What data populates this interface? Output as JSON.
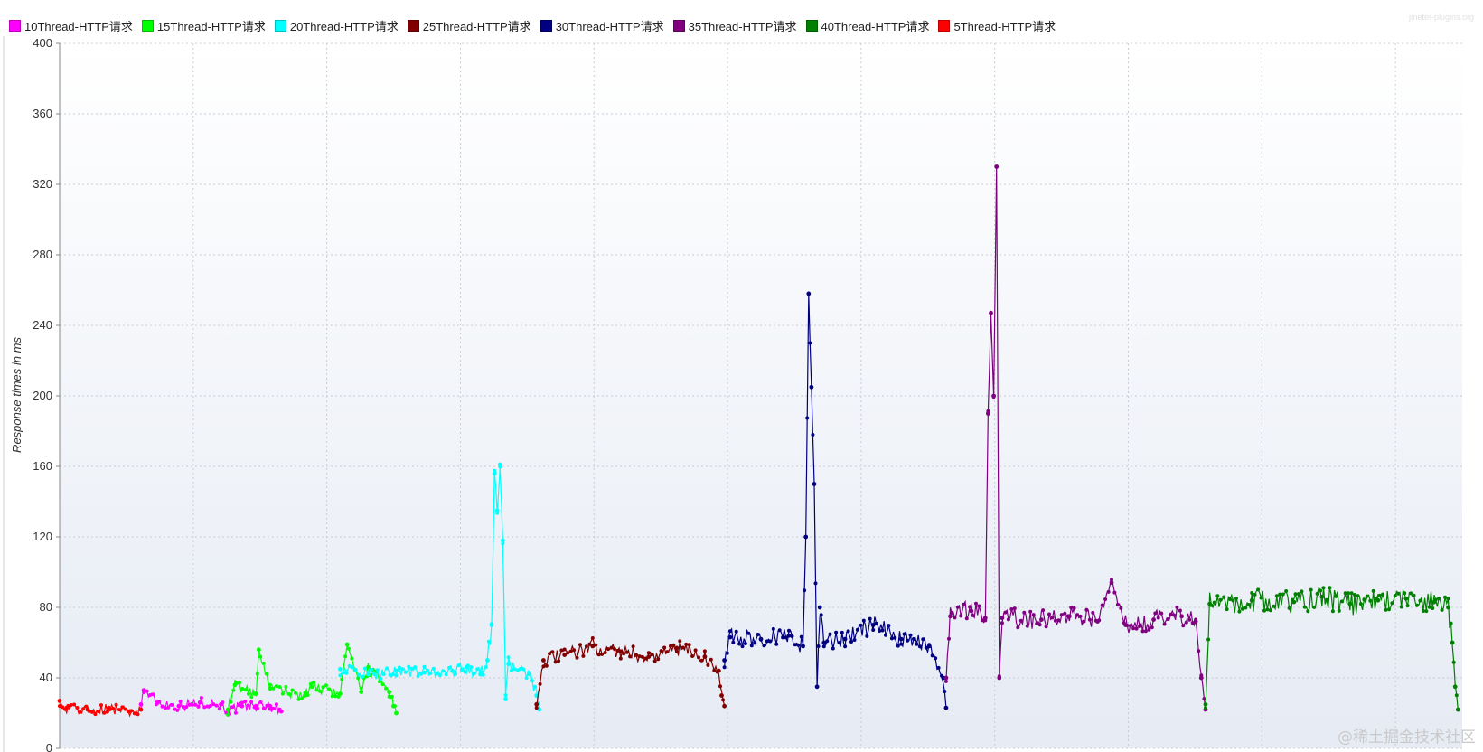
{
  "brand": "jmeter-plugins.org",
  "watermark": "@稀土掘金技术社区",
  "chart_data": {
    "type": "line",
    "title": "",
    "xlabel": "",
    "ylabel": "Response times in ms",
    "ylim": [
      0,
      400
    ],
    "yticks": [
      0,
      40,
      80,
      120,
      160,
      200,
      240,
      280,
      320,
      360,
      400
    ],
    "grid": true,
    "legend_position": "top-left",
    "x_unit": "fraction of elapsed test time",
    "series": [
      {
        "name": "10Thread-HTTP请求",
        "color": "#ff00ff",
        "points": [
          [
            0.058,
            25
          ],
          [
            0.06,
            33
          ],
          [
            0.07,
            26
          ],
          [
            0.085,
            24
          ],
          [
            0.1,
            26
          ],
          [
            0.115,
            25
          ],
          [
            0.12,
            21
          ],
          [
            0.13,
            24
          ],
          [
            0.14,
            24
          ],
          [
            0.15,
            24
          ],
          [
            0.158,
            21
          ]
        ]
      },
      {
        "name": "15Thread-HTTP请求",
        "color": "#00ff00",
        "points": [
          [
            0.12,
            22
          ],
          [
            0.125,
            36
          ],
          [
            0.14,
            31
          ],
          [
            0.142,
            56
          ],
          [
            0.15,
            34
          ],
          [
            0.175,
            30
          ],
          [
            0.18,
            35
          ],
          [
            0.2,
            31
          ],
          [
            0.205,
            59
          ],
          [
            0.215,
            32
          ],
          [
            0.22,
            46
          ],
          [
            0.235,
            32
          ],
          [
            0.238,
            24
          ],
          [
            0.24,
            20
          ]
        ]
      },
      {
        "name": "20Thread-HTTP请求",
        "color": "#00ffff",
        "points": [
          [
            0.2,
            45
          ],
          [
            0.22,
            42
          ],
          [
            0.24,
            44
          ],
          [
            0.26,
            43
          ],
          [
            0.28,
            44
          ],
          [
            0.29,
            46
          ],
          [
            0.3,
            42
          ],
          [
            0.305,
            50
          ],
          [
            0.308,
            70
          ],
          [
            0.31,
            156
          ],
          [
            0.312,
            135
          ],
          [
            0.314,
            161
          ],
          [
            0.316,
            118
          ],
          [
            0.318,
            28
          ],
          [
            0.32,
            48
          ],
          [
            0.335,
            42
          ],
          [
            0.34,
            30
          ],
          [
            0.342,
            22
          ]
        ]
      },
      {
        "name": "25Thread-HTTP请求",
        "color": "#800000",
        "points": [
          [
            0.34,
            25
          ],
          [
            0.345,
            50
          ],
          [
            0.36,
            53
          ],
          [
            0.38,
            58
          ],
          [
            0.4,
            55
          ],
          [
            0.42,
            52
          ],
          [
            0.44,
            57
          ],
          [
            0.46,
            52
          ],
          [
            0.47,
            44
          ],
          [
            0.472,
            30
          ],
          [
            0.474,
            24
          ]
        ]
      },
      {
        "name": "30Thread-HTTP请求",
        "color": "#000080",
        "points": [
          [
            0.474,
            50
          ],
          [
            0.478,
            63
          ],
          [
            0.5,
            62
          ],
          [
            0.52,
            64
          ],
          [
            0.53,
            58
          ],
          [
            0.532,
            120
          ],
          [
            0.534,
            258
          ],
          [
            0.536,
            205
          ],
          [
            0.538,
            150
          ],
          [
            0.54,
            35
          ],
          [
            0.542,
            80
          ],
          [
            0.545,
            60
          ],
          [
            0.56,
            62
          ],
          [
            0.58,
            70
          ],
          [
            0.6,
            62
          ],
          [
            0.62,
            58
          ],
          [
            0.63,
            40
          ],
          [
            0.632,
            23
          ]
        ]
      },
      {
        "name": "35Thread-HTTP请求",
        "color": "#800080",
        "points": [
          [
            0.632,
            40
          ],
          [
            0.635,
            75
          ],
          [
            0.65,
            78
          ],
          [
            0.66,
            74
          ],
          [
            0.662,
            190
          ],
          [
            0.664,
            247
          ],
          [
            0.666,
            200
          ],
          [
            0.668,
            330
          ],
          [
            0.67,
            40
          ],
          [
            0.672,
            74
          ],
          [
            0.7,
            73
          ],
          [
            0.72,
            75
          ],
          [
            0.74,
            72
          ],
          [
            0.75,
            94
          ],
          [
            0.76,
            70
          ],
          [
            0.78,
            73
          ],
          [
            0.8,
            75
          ],
          [
            0.81,
            72
          ],
          [
            0.814,
            40
          ],
          [
            0.817,
            22
          ]
        ]
      },
      {
        "name": "40Thread-HTTP请求",
        "color": "#008000",
        "points": [
          [
            0.817,
            25
          ],
          [
            0.82,
            82
          ],
          [
            0.85,
            84
          ],
          [
            0.88,
            83
          ],
          [
            0.9,
            86
          ],
          [
            0.92,
            82
          ],
          [
            0.94,
            84
          ],
          [
            0.96,
            85
          ],
          [
            0.98,
            83
          ],
          [
            0.99,
            80
          ],
          [
            0.993,
            60
          ],
          [
            0.995,
            35
          ],
          [
            0.997,
            22
          ]
        ]
      },
      {
        "name": "5Thread-HTTP请求",
        "color": "#ff0000",
        "points": [
          [
            0.0,
            27
          ],
          [
            0.005,
            23
          ],
          [
            0.02,
            22
          ],
          [
            0.035,
            23
          ],
          [
            0.05,
            21
          ],
          [
            0.058,
            22
          ]
        ]
      }
    ]
  }
}
